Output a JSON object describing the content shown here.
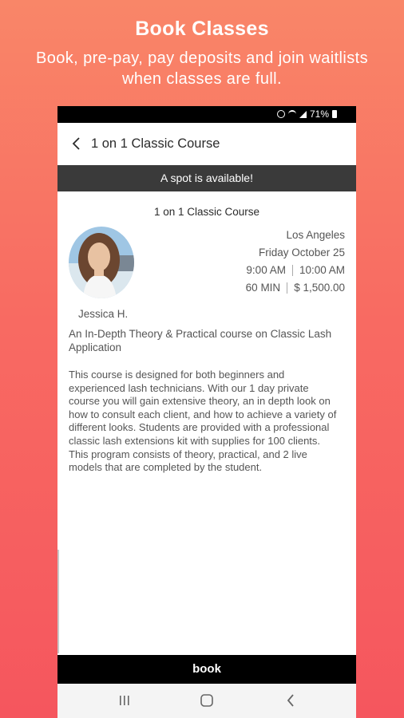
{
  "promo": {
    "title": "Book Classes",
    "subtitle": "Book, pre-pay, pay deposits and join waitlists when classes are full."
  },
  "status_bar": {
    "battery": "71%",
    "icons": [
      "alarm-icon",
      "wifi-icon",
      "signal-icon",
      "battery-icon"
    ]
  },
  "app_bar": {
    "title": "1 on 1 Classic Course",
    "back_icon": "back-arrow-icon"
  },
  "banner": {
    "text": "A spot is available!"
  },
  "course": {
    "title": "1 on 1 Classic Course",
    "instructor": "Jessica H.",
    "location": "Los Angeles",
    "date": "Friday October 25",
    "start_time": "9:00 AM",
    "end_time": "10:00 AM",
    "duration": "60 MIN",
    "price": "$ 1,500.00",
    "short_description": "An In-Depth Theory & Practical course on Classic Lash Application",
    "description": "This course is designed for both beginners and experienced lash technicians. With our 1 day private course you will gain extensive theory, an in depth look on how to consult each client, and how to achieve a variety of different looks. Students are provided with a professional classic lash extensions kit with supplies for 100 clients. This program consists of theory, practical, and 2 live models that are completed by the student."
  },
  "book_button": {
    "label": "book"
  },
  "nav_bar": {
    "icons": [
      "recent-apps-icon",
      "home-icon",
      "back-icon"
    ]
  },
  "colors": {
    "gradient_top": "#f98668",
    "gradient_bottom": "#f5565e",
    "banner": "#3a3a3a",
    "book_bar": "#000000"
  }
}
